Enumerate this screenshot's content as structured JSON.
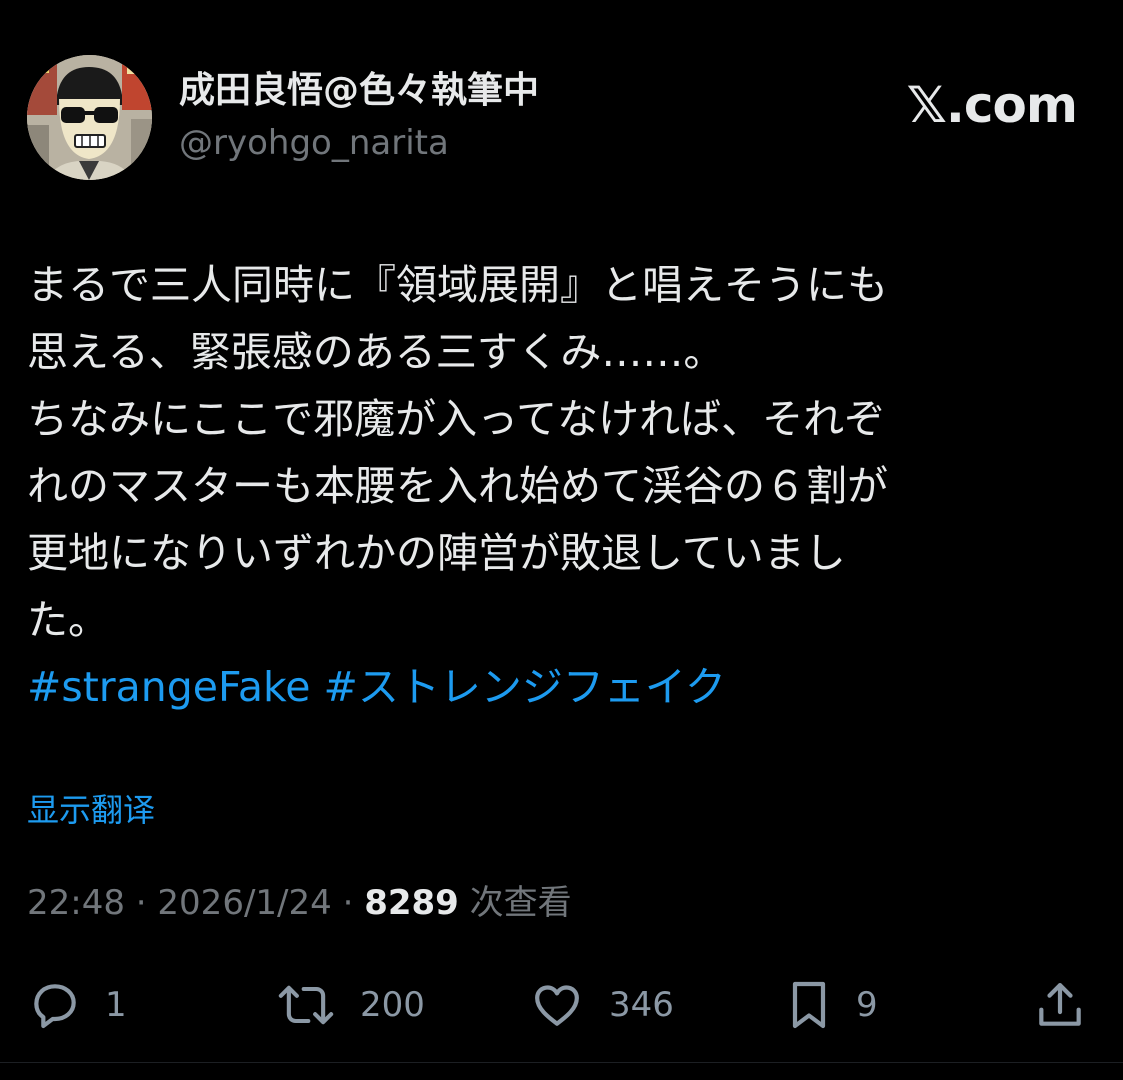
{
  "author": {
    "display_name": "成田良悟@色々執筆中",
    "handle": "@ryohgo_narita"
  },
  "site_logo": "𝕏.com",
  "tweet": {
    "text": "まるで三人同時に『領域展開』と唱えそうにも\n思える、緊張感のある三すくみ……。\nちなみにここで邪魔が入ってなければ、それぞ\nれのマスターも本腰を入れ始めて渓谷の６割が\n更地になりいずれかの陣営が敗退していまし\nた。",
    "hashtags": [
      "#strangeFake",
      "#ストレンジフェイク"
    ]
  },
  "translate_label": "显示翻译",
  "meta": {
    "time": "22:48",
    "separator": "·",
    "date": "2026/1/24",
    "views_count": "8289",
    "views_label": "次查看"
  },
  "actions": {
    "reply_count": "1",
    "retweet_count": "200",
    "like_count": "346",
    "bookmark_count": "9"
  },
  "colors": {
    "background": "#000000",
    "text_primary": "#e7e9ea",
    "text_secondary": "#71767b",
    "link": "#1d9bf0"
  },
  "icons": {
    "reply": "speech-bubble-icon",
    "retweet": "retweet-arrows-icon",
    "like": "heart-icon",
    "bookmark": "bookmark-icon",
    "share": "share-upload-icon"
  }
}
